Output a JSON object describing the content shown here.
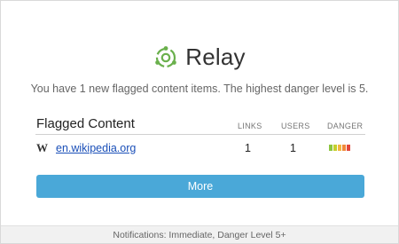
{
  "header": {
    "brand": "Relay",
    "logo_icon": "relay-logo-icon",
    "logo_color": "#6ab04c"
  },
  "summary": "You have 1 new flagged content items. The highest danger level is 5.",
  "flagged": {
    "title": "Flagged Content",
    "columns": {
      "links": "LINKS",
      "users": "USERS",
      "danger": "DANGER"
    },
    "rows": [
      {
        "icon": "wikipedia-icon",
        "icon_glyph": "W",
        "site": "en.wikipedia.org",
        "links": "1",
        "users": "1",
        "danger_level": 5,
        "danger_colors": [
          "#8dc63f",
          "#c4d02d",
          "#f4b63f",
          "#f08a3b",
          "#e2473b"
        ]
      }
    ]
  },
  "more_button": {
    "label": "More",
    "color": "#4aa8d8"
  },
  "footer": {
    "text": "Notifications: Immediate, Danger Level 5+"
  }
}
